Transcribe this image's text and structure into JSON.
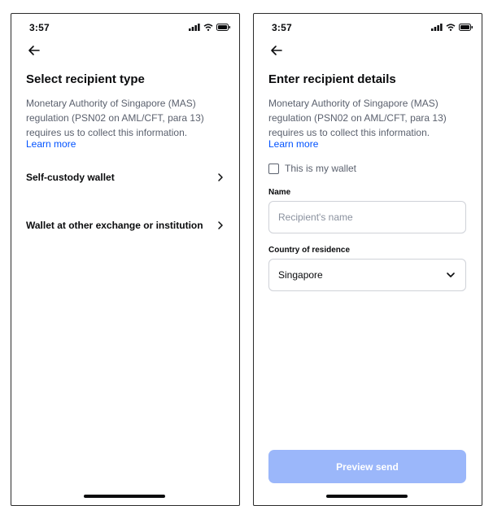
{
  "left_screen": {
    "time": "3:57",
    "title": "Select recipient type",
    "description": "Monetary Authority of Singapore (MAS) regulation (PSN02 on AML/CFT, para 13) requires us to collect this information.",
    "learn_more": "Learn more",
    "options": [
      {
        "label": "Self-custody wallet"
      },
      {
        "label": "Wallet at other exchange or institution"
      }
    ]
  },
  "right_screen": {
    "time": "3:57",
    "title": "Enter recipient details",
    "description": "Monetary Authority of Singapore (MAS) regulation (PSN02 on AML/CFT, para 13) requires us to collect this information.",
    "learn_more": "Learn more",
    "my_wallet_checkbox": {
      "label": "This is my wallet",
      "checked": false
    },
    "name_field": {
      "label": "Name",
      "placeholder": "Recipient's name",
      "value": ""
    },
    "country_field": {
      "label": "Country of residence",
      "value": "Singapore"
    },
    "preview_button": {
      "label": "Preview send",
      "enabled": false
    }
  },
  "colors": {
    "accent": "#0052ff",
    "button_disabled": "#9bb7fa",
    "text_primary": "#0a0b0d",
    "text_secondary": "#5b616e"
  },
  "icons": {
    "back": "arrow-left-icon",
    "option_chevron": "chevron-right-icon",
    "dropdown": "chevron-down-icon",
    "status": [
      "signal-icon",
      "wifi-icon",
      "battery-icon"
    ]
  }
}
